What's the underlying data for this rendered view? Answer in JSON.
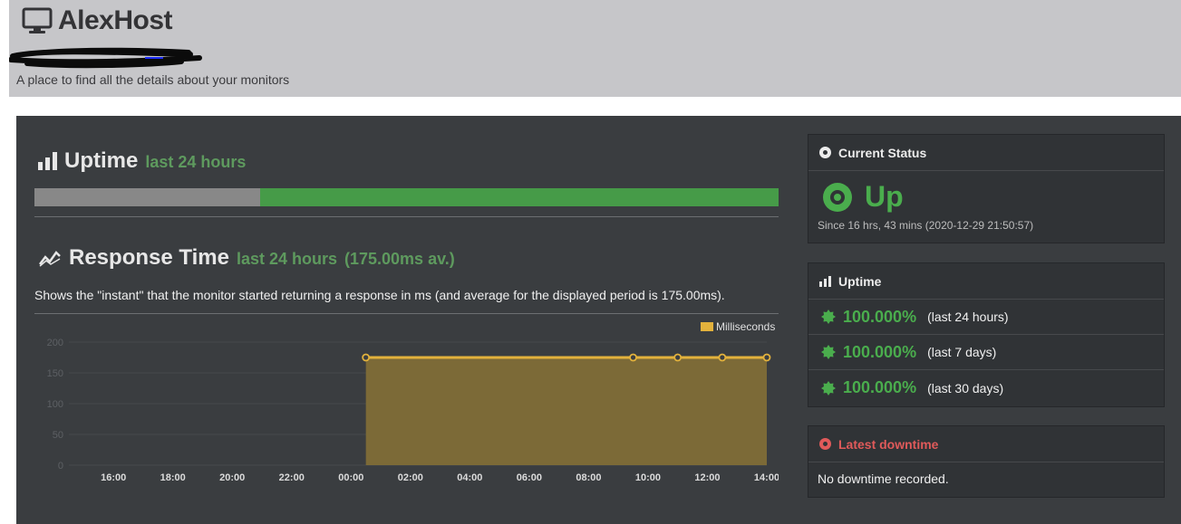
{
  "header": {
    "brand": "AlexHost",
    "tagline": "A place to find all the details about your monitors"
  },
  "uptime_section": {
    "title": "Uptime",
    "subtitle": "last 24 hours",
    "bar_up_fraction": 0.697
  },
  "response_section": {
    "title": "Response Time",
    "subtitle": "last 24 hours",
    "average": "(175.00ms av.)",
    "description": "Shows the \"instant\" that the monitor started returning a response in ms (and average for the displayed period is 175.00ms)."
  },
  "chart_data": {
    "type": "area",
    "x": [
      "00:30",
      "09:30",
      "11:00",
      "12:30",
      "14:00"
    ],
    "values": [
      175,
      175,
      175,
      175,
      175
    ],
    "series": [
      {
        "name": "Milliseconds",
        "values": [
          175,
          175,
          175,
          175,
          175
        ]
      }
    ],
    "categories": [
      "16:00",
      "18:00",
      "20:00",
      "22:00",
      "00:00",
      "02:00",
      "04:00",
      "06:00",
      "08:00",
      "10:00",
      "12:00",
      "14:00"
    ],
    "x_start": "14:30",
    "ylim": [
      0,
      200
    ],
    "yticks": [
      0,
      50,
      100,
      150,
      200
    ],
    "legend": "top-right",
    "grid": true,
    "colors": {
      "line": "#e3b23c",
      "fill": "#7c6a37"
    }
  },
  "current_status": {
    "title": "Current Status",
    "state": "Up",
    "since": "Since 16 hrs, 43 mins (2020-12-29 21:50:57)"
  },
  "uptime_card": {
    "title": "Uptime",
    "rows": [
      {
        "pct": "100.000%",
        "period": "(last 24 hours)"
      },
      {
        "pct": "100.000%",
        "period": "(last 7 days)"
      },
      {
        "pct": "100.000%",
        "period": "(last 30 days)"
      }
    ]
  },
  "downtime_card": {
    "title": "Latest downtime",
    "text": "No downtime recorded."
  },
  "colors": {
    "green": "#4aad4d",
    "red": "#e05a5a",
    "panel": "#3a3d40",
    "header": "#c6c6c9"
  }
}
